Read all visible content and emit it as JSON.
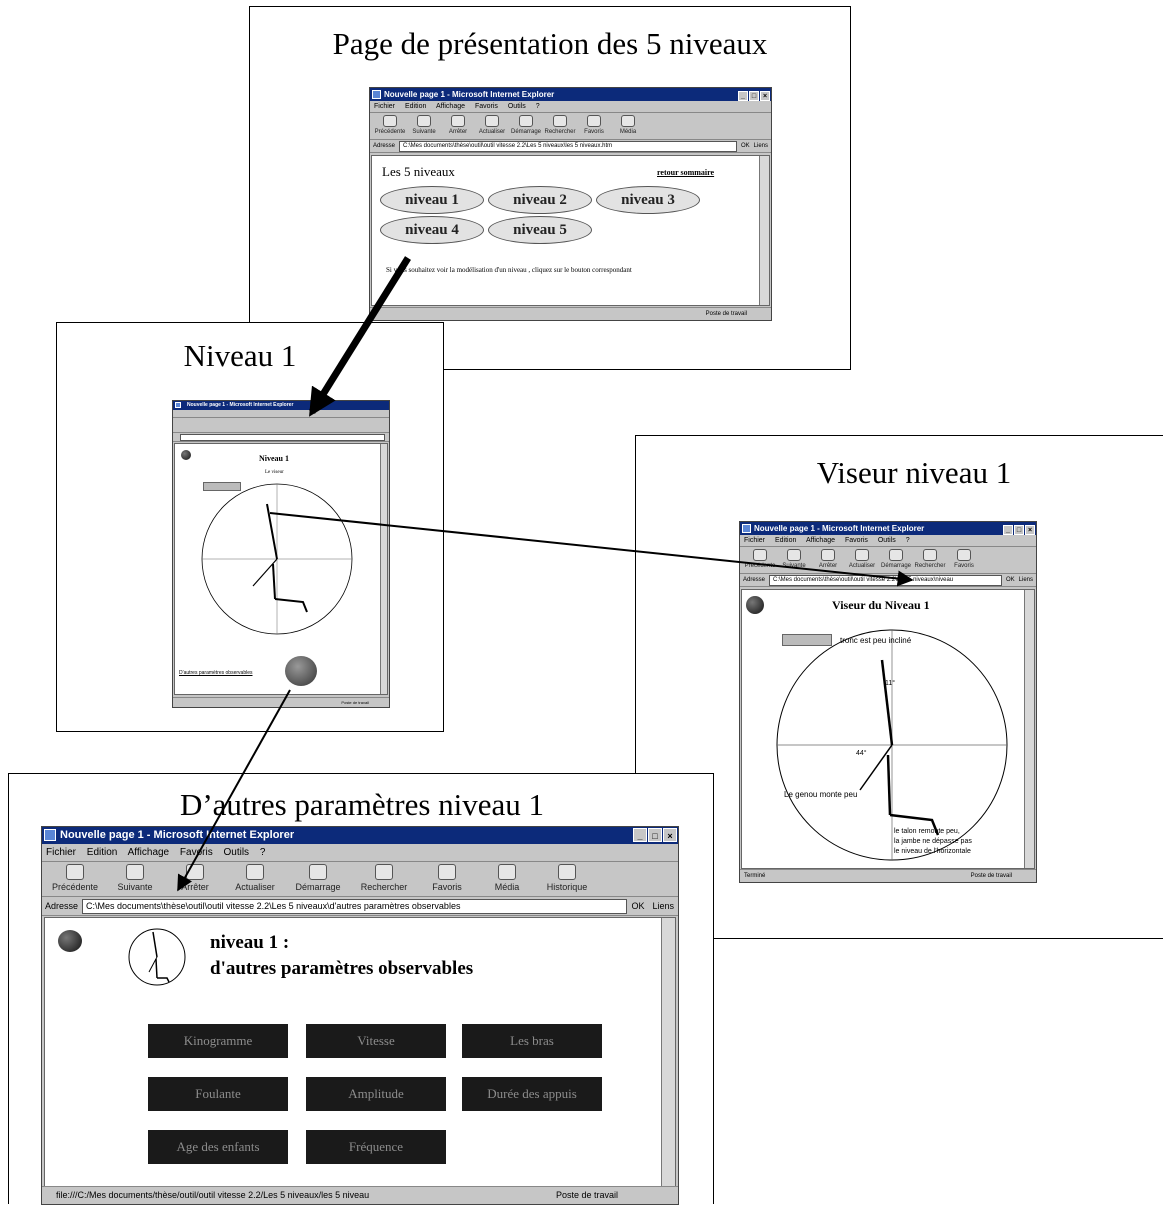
{
  "panels": {
    "presentation": {
      "title": "Page de présentation des 5 niveaux"
    },
    "niveau1": {
      "title": "Niveau 1"
    },
    "viseur": {
      "title": "Viseur niveau 1"
    },
    "autres": {
      "title": "D’autres paramètres niveau 1"
    }
  },
  "win_pres": {
    "titlebar": "Nouvelle page 1 - Microsoft Internet Explorer",
    "menu": [
      "Fichier",
      "Edition",
      "Affichage",
      "Favoris",
      "Outils",
      "?"
    ],
    "toolbar": [
      "Précédente",
      "Suivante",
      "Arrêter",
      "Actualiser",
      "Démarrage",
      "Rechercher",
      "Favoris",
      "Média"
    ],
    "address_label": "Adresse",
    "address": "C:\\Mes documents\\thèse\\outil\\outil vitesse 2.2\\Les 5 niveaux\\les 5 niveaux.htm",
    "go": "OK",
    "links": "Liens",
    "heading": "Les 5 niveaux",
    "retour": "retour sommaire",
    "levels": [
      "niveau 1",
      "niveau 2",
      "niveau 3",
      "niveau 4",
      "niveau 5"
    ],
    "hint": "Si vous souhaitez voir la modélisation d'un niveau , cliquez sur le bouton correspondant",
    "status": "Poste de travail"
  },
  "win_n1": {
    "titlebar": "Nouvelle page 1 - Microsoft Internet Explorer",
    "heading": "Niveau 1",
    "sub": "Le viseur",
    "footer_link": "D'autres paramètres observables",
    "status": "Poste de travail"
  },
  "win_viseur": {
    "titlebar": "Nouvelle page 1 - Microsoft Internet Explorer",
    "menu": [
      "Fichier",
      "Edition",
      "Affichage",
      "Favoris",
      "Outils",
      "?"
    ],
    "toolbar": [
      "Précédente",
      "Suivante",
      "Arrêter",
      "Actualiser",
      "Démarrage",
      "Rechercher",
      "Favoris"
    ],
    "address_label": "Adresse",
    "address": "C:\\Mes documents\\thèse\\outil\\outil vitesse 2.2\\Les 5 niveaux\\niveau",
    "go": "OK",
    "links": "Liens",
    "heading": "Viseur du  Niveau 1",
    "trunk": "tronc est peu incliné",
    "angle_top": "11°",
    "angle_knee": "44°",
    "knee": "Le genou monte peu",
    "heel_1": "le talon remonte peu,",
    "heel_2": "la jambe ne dépasse pas",
    "heel_3": "le niveau de l'horizontale",
    "status_left": "Terminé",
    "status": "Poste de travail"
  },
  "win_autres": {
    "titlebar": "Nouvelle page 1 - Microsoft Internet Explorer",
    "menu": [
      "Fichier",
      "Edition",
      "Affichage",
      "Favoris",
      "Outils",
      "?"
    ],
    "toolbar": [
      "Précédente",
      "Suivante",
      "Arrêter",
      "Actualiser",
      "Démarrage",
      "Rechercher",
      "Favoris",
      "Média",
      "Historique"
    ],
    "address_label": "Adresse",
    "address": "C:\\Mes documents\\thèse\\outil\\outil vitesse 2.2\\Les 5 niveaux\\d'autres paramètres observables",
    "go": "OK",
    "links": "Liens",
    "heading_1": "niveau 1 :",
    "heading_2": "d'autres paramètres observables",
    "buttons": [
      "Kinogramme",
      "Vitesse",
      "Les bras",
      "Foulante",
      "Amplitude",
      "Durée des appuis",
      "Age des enfants",
      "Fréquence"
    ],
    "status": "file:///C:/Mes documents/thèse/outil/outil vitesse 2.2/Les 5 niveaux/les 5 niveau",
    "status_right": "Poste de travail"
  }
}
